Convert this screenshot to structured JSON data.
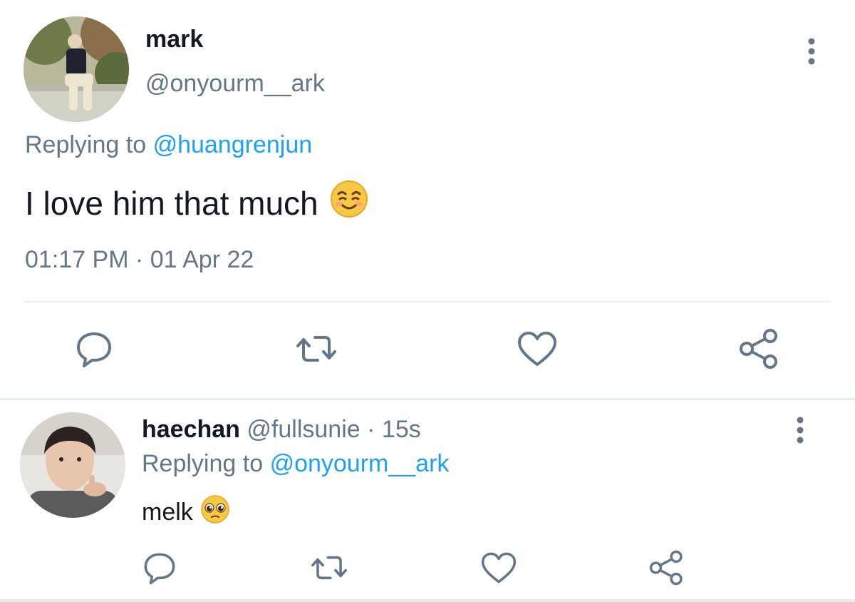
{
  "main_tweet": {
    "name": "mark",
    "handle": "@onyourm__ark",
    "replying_prefix": "Replying to",
    "replying_handle": "@huangrenjun",
    "text": "I love him that much",
    "emoji": "smiling-face-with-smiling-eyes",
    "timestamp": "01:17 PM · 01 Apr 22"
  },
  "reply_tweet": {
    "name": "haechan",
    "handle": "@fullsunie",
    "separator": "·",
    "age": "15s",
    "replying_prefix": "Replying to",
    "replying_handle": "@onyourm__ark",
    "text": "melk",
    "emoji": "pleading-face"
  },
  "actions": [
    "reply-icon",
    "retweet-icon",
    "like-icon",
    "share-icon"
  ],
  "colors": {
    "link": "#1da1f2",
    "secondary_text": "#657786",
    "primary_text": "#141823",
    "icon": "#657786",
    "divider": "#e6ecf0"
  }
}
